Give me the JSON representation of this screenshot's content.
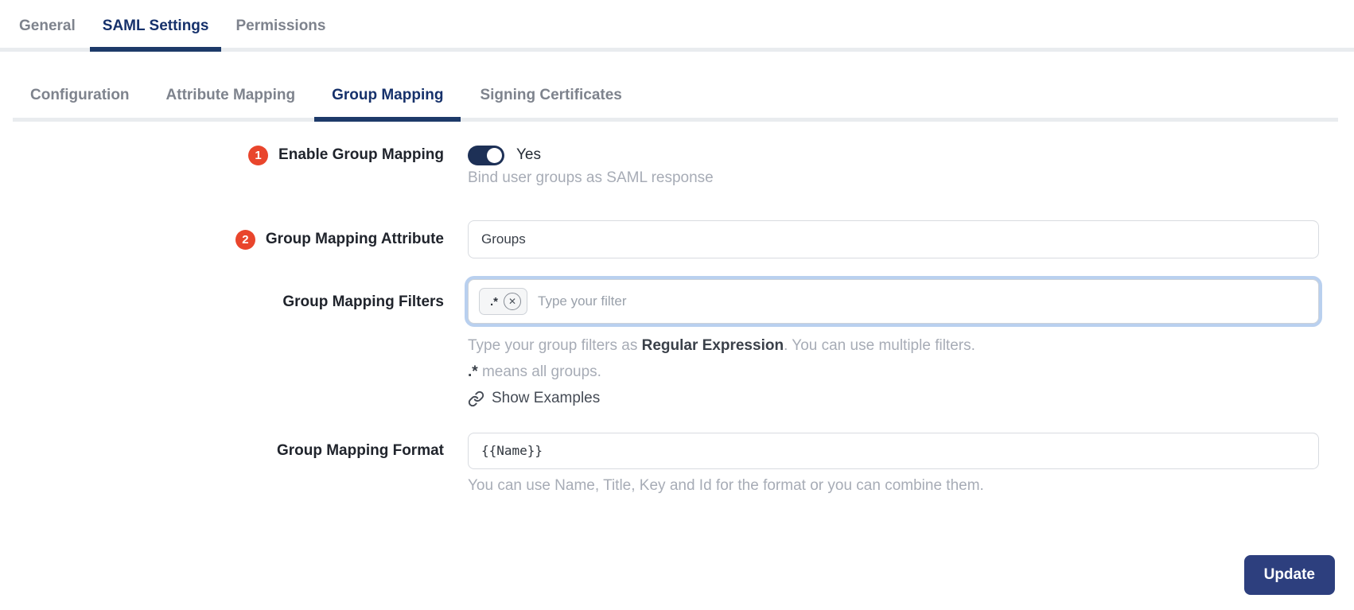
{
  "main_tabs": [
    {
      "label": "General",
      "active": false
    },
    {
      "label": "SAML Settings",
      "active": true
    },
    {
      "label": "Permissions",
      "active": false
    }
  ],
  "sub_tabs": [
    {
      "label": "Configuration",
      "active": false
    },
    {
      "label": "Attribute Mapping",
      "active": false
    },
    {
      "label": "Group Mapping",
      "active": true
    },
    {
      "label": "Signing Certificates",
      "active": false
    }
  ],
  "form": {
    "enable_group_mapping": {
      "step_badge": "1",
      "label": "Enable Group Mapping",
      "toggle_state": "on",
      "toggle_label": "Yes",
      "help": "Bind user groups as SAML response"
    },
    "group_mapping_attribute": {
      "step_badge": "2",
      "label": "Group Mapping Attribute",
      "value": "Groups"
    },
    "group_mapping_filters": {
      "label": "Group Mapping Filters",
      "chip_value": ".*",
      "placeholder": "Type your filter",
      "help_prefix": "Type your group filters as ",
      "help_emphasis": "Regular Expression",
      "help_suffix": ". You can use multiple filters.",
      "help2_emphasis": ".*",
      "help2_suffix": " means all groups.",
      "examples_link_label": "Show Examples"
    },
    "group_mapping_format": {
      "label": "Group Mapping Format",
      "value": "{{Name}}",
      "help": "You can use Name, Title, Key and Id for the format or you can combine them."
    },
    "update_button_label": "Update"
  },
  "icons": {
    "remove_filter_glyph": "✕"
  },
  "colors": {
    "accent_navy": "#1d3a69",
    "toggle_navy": "#1d3056",
    "button_navy": "#2d3f7e",
    "badge_red": "#e9452c",
    "focus_ring_blue": "#b9d0ef",
    "divider_gray": "#e9ecef",
    "help_gray": "#a7acb6"
  }
}
